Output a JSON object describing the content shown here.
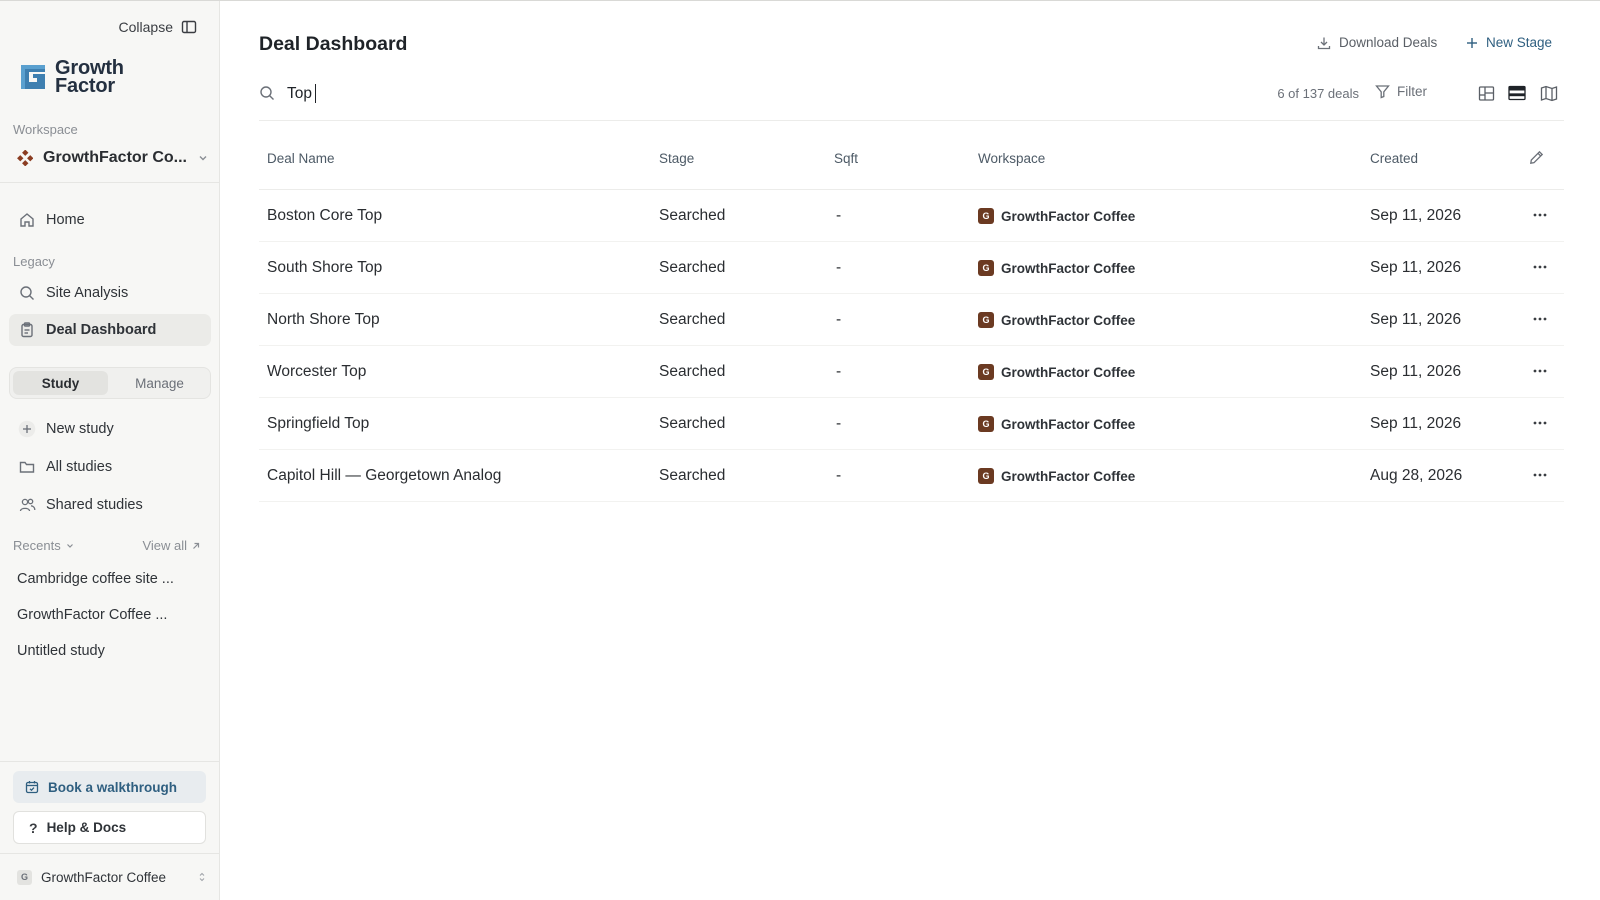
{
  "sidebar": {
    "collapse_label": "Collapse",
    "logo_line1": "Growth",
    "logo_line2": "Factor",
    "workspace_label": "Workspace",
    "workspace_name": "GrowthFactor Co...",
    "home_label": "Home",
    "legacy_label": "Legacy",
    "site_analysis_label": "Site Analysis",
    "deal_dashboard_label": "Deal Dashboard",
    "tabs": [
      {
        "label": "Study",
        "active": true
      },
      {
        "label": "Manage",
        "active": false
      }
    ],
    "new_study_label": "New study",
    "all_studies_label": "All studies",
    "shared_studies_label": "Shared studies",
    "recents_label": "Recents",
    "view_all_label": "View all",
    "recents": [
      "Cambridge coffee site ...",
      "GrowthFactor Coffee ...",
      "Untitled study"
    ],
    "book_walkthrough_label": "Book a walkthrough",
    "help_docs_label": "Help & Docs",
    "account_name": "GrowthFactor Coffee",
    "account_badge": "G"
  },
  "header": {
    "title": "Deal Dashboard",
    "download_label": "Download Deals",
    "new_stage_label": "New Stage"
  },
  "search": {
    "value": "Top",
    "count_text": "6 of 137 deals",
    "filter_label": "Filter",
    "view_mode": "table"
  },
  "table": {
    "columns": [
      "Deal Name",
      "Stage",
      "Sqft",
      "Workspace",
      "Created"
    ],
    "rows": [
      {
        "name": "Boston Core Top",
        "stage": "Searched",
        "sqft": "-",
        "workspace": "GrowthFactor Coffee",
        "badge": "G",
        "created": "Sep 11, 2026"
      },
      {
        "name": "South Shore Top",
        "stage": "Searched",
        "sqft": "-",
        "workspace": "GrowthFactor Coffee",
        "badge": "G",
        "created": "Sep 11, 2026"
      },
      {
        "name": "North Shore Top",
        "stage": "Searched",
        "sqft": "-",
        "workspace": "GrowthFactor Coffee",
        "badge": "G",
        "created": "Sep 11, 2026"
      },
      {
        "name": "Worcester Top",
        "stage": "Searched",
        "sqft": "-",
        "workspace": "GrowthFactor Coffee",
        "badge": "G",
        "created": "Sep 11, 2026"
      },
      {
        "name": "Springfield Top",
        "stage": "Searched",
        "sqft": "-",
        "workspace": "GrowthFactor Coffee",
        "badge": "G",
        "created": "Sep 11, 2026"
      },
      {
        "name": "Capitol Hill — Georgetown Analog",
        "stage": "Searched",
        "sqft": "-",
        "workspace": "GrowthFactor Coffee",
        "badge": "G",
        "created": "Aug 28, 2026"
      }
    ]
  },
  "colors": {
    "brand_logo": "#3e7fb0",
    "accent_link": "#2f5f80",
    "workspace_badge": "#6b3a22",
    "workspace_diamond": "#8b3d22",
    "sidebar_bg": "#f7f7f5"
  },
  "icons": {
    "collapse": "sidebar-panel-icon",
    "home": "home-icon",
    "site_analysis": "search-icon",
    "deal_dashboard": "clipboard-icon",
    "new_study": "plus-icon",
    "all_studies": "folder-icon",
    "shared_studies": "users-icon",
    "book": "calendar-icon",
    "help": "question-icon",
    "download": "download-icon",
    "new_stage": "plus-icon",
    "filter": "filter-icon",
    "views": [
      "kanban-view-icon",
      "table-view-icon",
      "map-view-icon"
    ]
  }
}
